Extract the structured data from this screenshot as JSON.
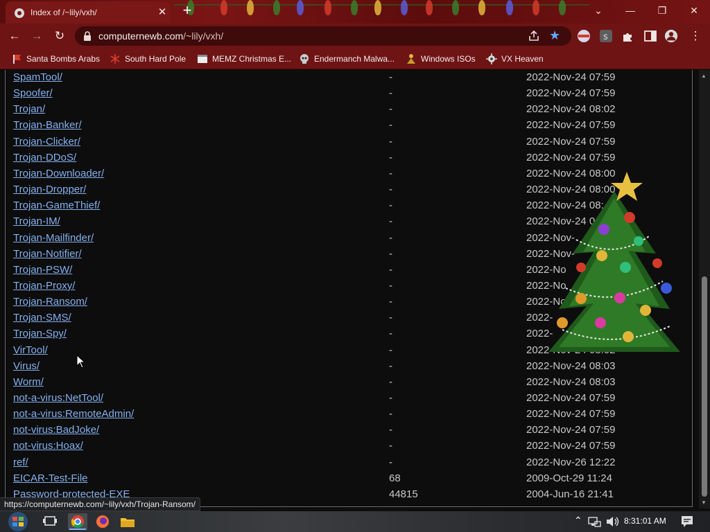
{
  "browser": {
    "tab_title": "Index of /~lily/vxh/",
    "url_host": "computernewb.com",
    "url_path": "/~lily/vxh/",
    "status_url": "https://computernewb.com/~lily/vxh/Trojan-Ransom/"
  },
  "bookmarks": [
    {
      "label": "Santa Bombs Arabs",
      "icon": "flag-icon"
    },
    {
      "label": "South Hard Pole",
      "icon": "snowflake-icon"
    },
    {
      "label": "MEMZ Christmas E...",
      "icon": "window-icon"
    },
    {
      "label": "Endermanch Malwa...",
      "icon": "skull-icon"
    },
    {
      "label": "Windows ISOs",
      "icon": "person-icon"
    },
    {
      "label": "VX Heaven",
      "icon": "virus-icon"
    }
  ],
  "listing": [
    {
      "name": "SpamTool/",
      "size": "-",
      "date": "2022-Nov-24 07:59"
    },
    {
      "name": "Spoofer/",
      "size": "-",
      "date": "2022-Nov-24 07:59"
    },
    {
      "name": "Trojan/",
      "size": "-",
      "date": "2022-Nov-24 08:02"
    },
    {
      "name": "Trojan-Banker/",
      "size": "-",
      "date": "2022-Nov-24 07:59"
    },
    {
      "name": "Trojan-Clicker/",
      "size": "-",
      "date": "2022-Nov-24 07:59"
    },
    {
      "name": "Trojan-DDoS/",
      "size": "-",
      "date": "2022-Nov-24 07:59"
    },
    {
      "name": "Trojan-Downloader/",
      "size": "-",
      "date": "2022-Nov-24 08:00"
    },
    {
      "name": "Trojan-Dropper/",
      "size": "-",
      "date": "2022-Nov-24 08:00"
    },
    {
      "name": "Trojan-GameThief/",
      "size": "-",
      "date": "2022-Nov-24 08:"
    },
    {
      "name": "Trojan-IM/",
      "size": "-",
      "date": "2022-Nov-24 0"
    },
    {
      "name": "Trojan-Mailfinder/",
      "size": "-",
      "date": "2022-Nov-"
    },
    {
      "name": "Trojan-Notifier/",
      "size": "-",
      "date": "2022-Nov-"
    },
    {
      "name": "Trojan-PSW/",
      "size": "-",
      "date": "2022-No"
    },
    {
      "name": "Trojan-Proxy/",
      "size": "-",
      "date": "2022-No"
    },
    {
      "name": "Trojan-Ransom/",
      "size": "-",
      "date": "2022-No"
    },
    {
      "name": "Trojan-SMS/",
      "size": "-",
      "date": "2022-"
    },
    {
      "name": "Trojan-Spy/",
      "size": "-",
      "date": "2022-"
    },
    {
      "name": "VirTool/",
      "size": "-",
      "date": "2022-Nov-24 08:02"
    },
    {
      "name": "Virus/",
      "size": "-",
      "date": "2022-Nov-24 08:03"
    },
    {
      "name": "Worm/",
      "size": "-",
      "date": "2022-Nov-24 08:03"
    },
    {
      "name": "not-a-virus:NetTool/",
      "size": "-",
      "date": "2022-Nov-24 07:59"
    },
    {
      "name": "not-a-virus:RemoteAdmin/",
      "size": "-",
      "date": "2022-Nov-24 07:59"
    },
    {
      "name": "not-virus:BadJoke/",
      "size": "-",
      "date": "2022-Nov-24 07:59"
    },
    {
      "name": "not-virus:Hoax/",
      "size": "-",
      "date": "2022-Nov-24 07:59"
    },
    {
      "name": "ref/",
      "size": "-",
      "date": "2022-Nov-26 12:22"
    },
    {
      "name": "EICAR-Test-File",
      "size": "68",
      "date": "2009-Oct-29 11:24"
    },
    {
      "name": "Password-protected-EXE",
      "size": "44815",
      "date": "2004-Jun-16 21:41"
    }
  ],
  "taskbar": {
    "clock": "8:31:01 AM"
  },
  "colors": {
    "theme": "#6e1414",
    "link": "#84b0ee",
    "text": "#c9c9c9"
  }
}
